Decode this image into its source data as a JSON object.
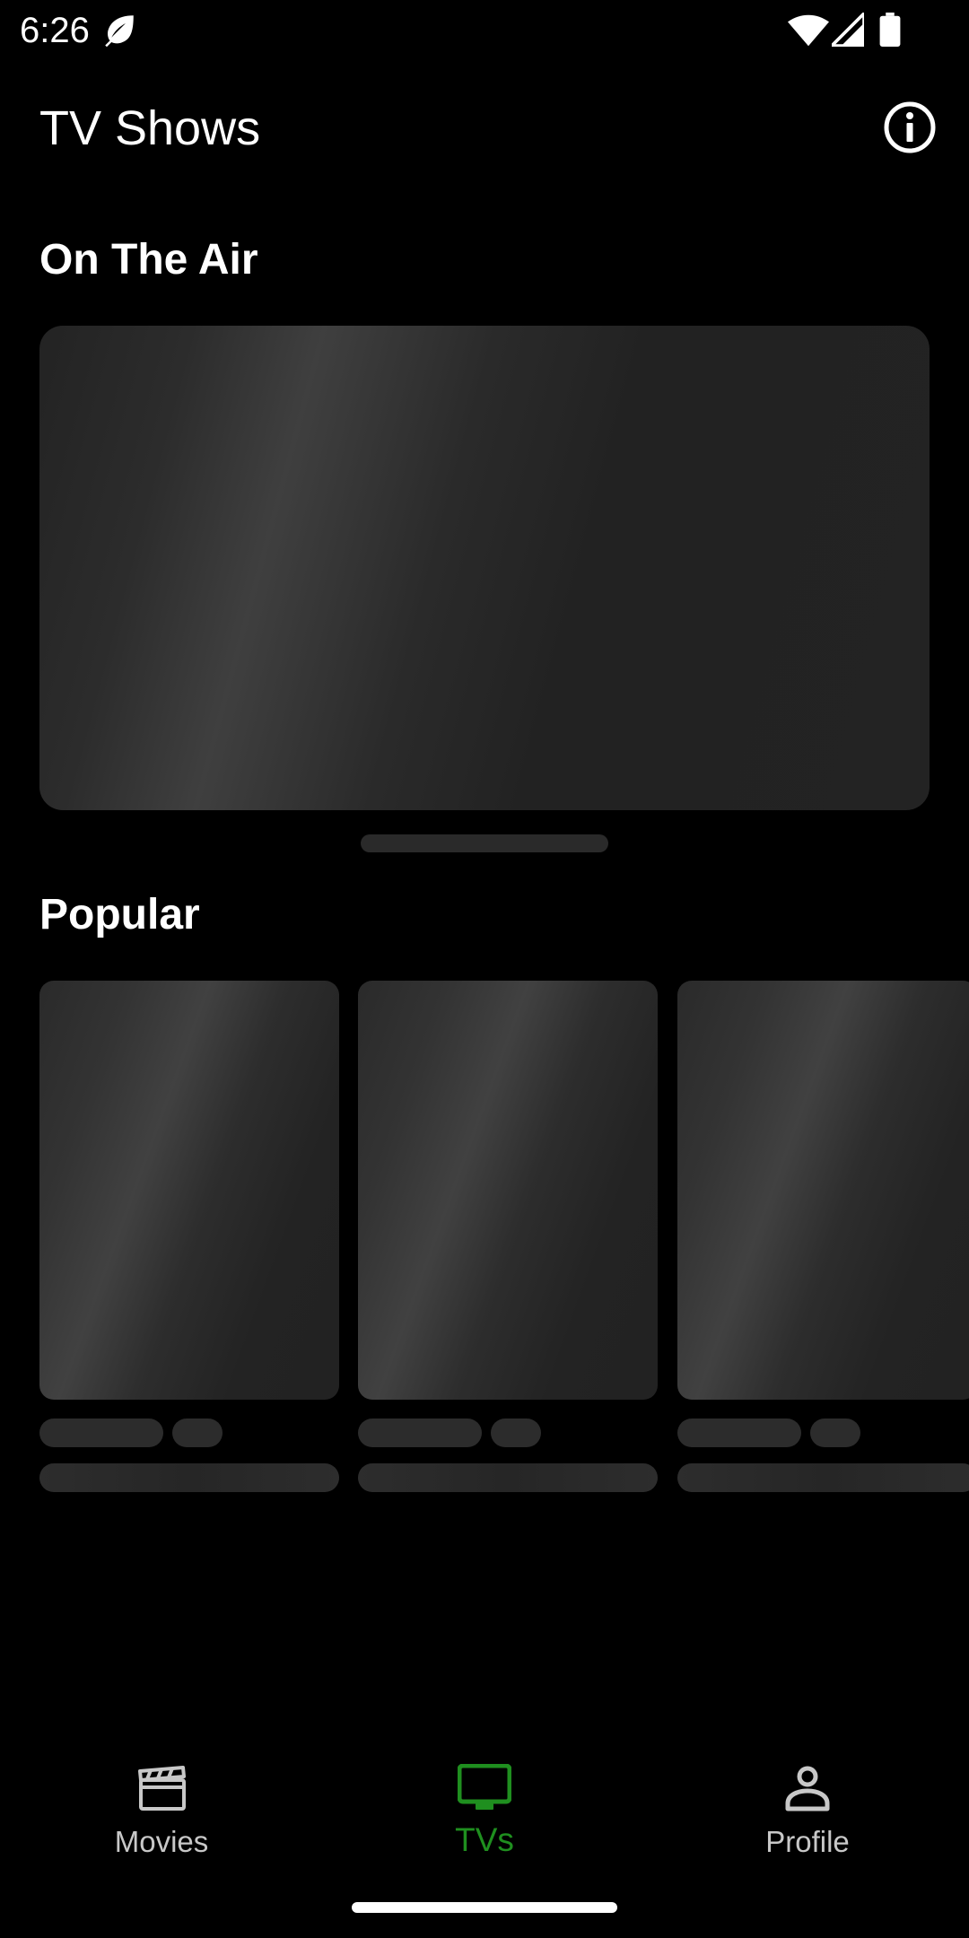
{
  "status_bar": {
    "time": "6:26",
    "icons": [
      "leaf-icon",
      "wifi-icon",
      "signal-icon",
      "battery-icon"
    ]
  },
  "app_bar": {
    "title": "TV Shows",
    "action_icon": "info-icon"
  },
  "sections": {
    "on_the_air": {
      "title": "On The Air"
    },
    "popular": {
      "title": "Popular"
    }
  },
  "bottom_nav": {
    "items": [
      {
        "label": "Movies",
        "icon": "clapperboard-icon",
        "selected": false
      },
      {
        "label": "TVs",
        "icon": "tv-icon",
        "selected": true
      },
      {
        "label": "Profile",
        "icon": "person-icon",
        "selected": false
      }
    ]
  },
  "colors": {
    "background": "#000000",
    "accent": "#1f8f1f",
    "skeleton": "#2a2a2a",
    "inactive_nav": "#c8c8c8"
  }
}
